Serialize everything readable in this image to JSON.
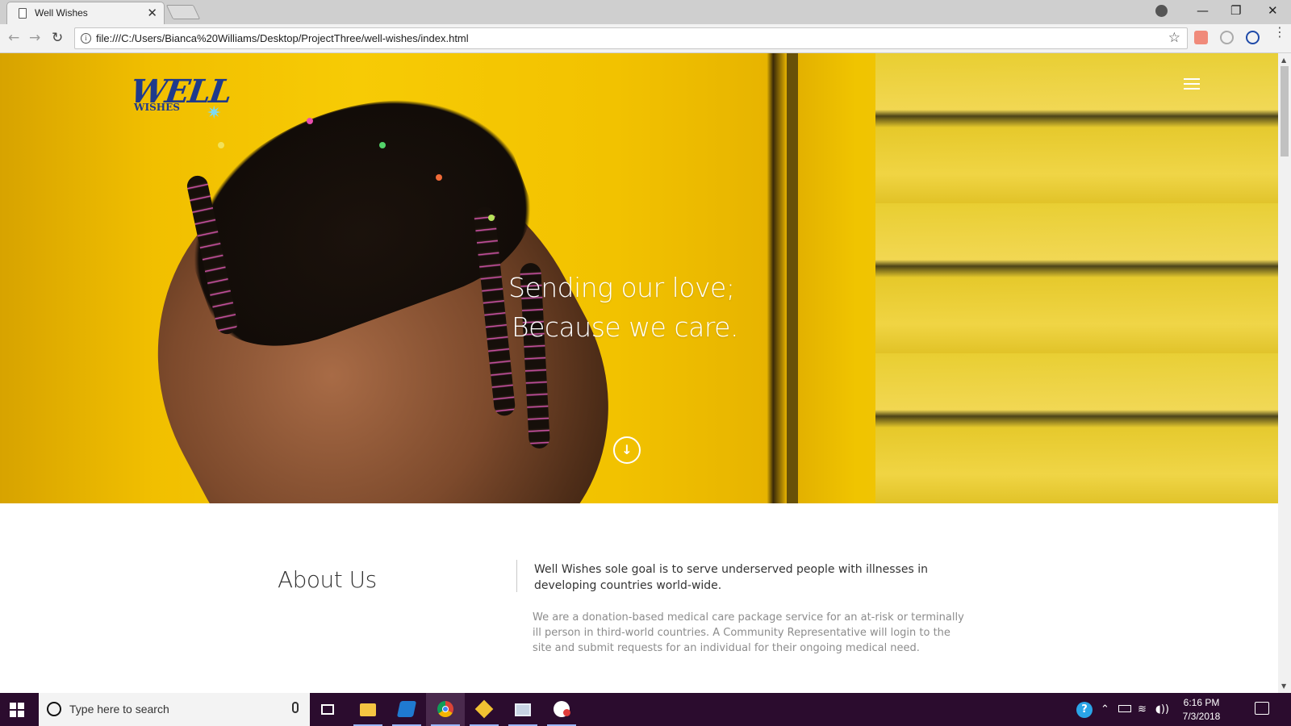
{
  "browser": {
    "tab_title": "Well Wishes",
    "tab_close": "✕",
    "url": "file:///C:/Users/Bianca%20Williams/Desktop/ProjectThree/well-wishes/index.html",
    "window_controls": {
      "minimize": "—",
      "restore": "❐",
      "close": "✕"
    },
    "nav": {
      "back": "←",
      "forward": "→",
      "reload": "↻"
    },
    "star": "☆",
    "menu": "⋮"
  },
  "site": {
    "logo": {
      "well": "WELL",
      "wishes": "WISHES",
      "spark": "✷"
    },
    "hero": {
      "line1": "Sending our love;",
      "line2": "Because we care.",
      "scroll_icon": "↓"
    },
    "about": {
      "title": "About Us",
      "lead": "Well Wishes sole goal is to serve underserved people with illnesses in developing countries world-wide.",
      "body": "We are a donation-based medical care package service for an at-risk or terminally ill person in third-world countries. A Community Representative will login to the site and submit requests for an individual for their ongoing medical need."
    }
  },
  "taskbar": {
    "search_placeholder": "Type here to search",
    "clock_time": "6:16 PM",
    "clock_date": "7/3/2018"
  },
  "colors": {
    "hero_yellow": "#f2c200",
    "logo_blue": "#1f3a8c",
    "taskbar": "#2b0c2e"
  }
}
